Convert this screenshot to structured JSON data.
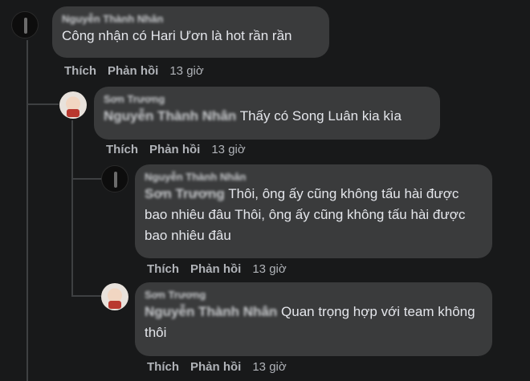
{
  "comments": [
    {
      "author": "Nguyễn Thành Nhân",
      "text": "Công nhận có Hari Ươn là hot rần rần",
      "like_label": "Thích",
      "reply_label": "Phản hồi",
      "time": "13 giờ"
    },
    {
      "author": "Sơn Trương",
      "mention": "Nguyễn Thành Nhân",
      "text": "Thấy có Song Luân kia kìa",
      "like_label": "Thích",
      "reply_label": "Phản hồi",
      "time": "13 giờ"
    },
    {
      "author": "Nguyễn Thành Nhân",
      "mention": "Sơn Trương",
      "text": "Thôi, ông ấy cũng không tấu hài được bao nhiêu đâu Thôi, ông ấy cũng không tấu hài được bao nhiêu đâu",
      "like_label": "Thích",
      "reply_label": "Phản hồi",
      "time": "13 giờ"
    },
    {
      "author": "Sơn Trương",
      "mention": "Nguyễn Thành Nhân",
      "text": "Quan trọng hợp với team không thôi",
      "like_label": "Thích",
      "reply_label": "Phản hồi",
      "time": "13 giờ"
    }
  ]
}
